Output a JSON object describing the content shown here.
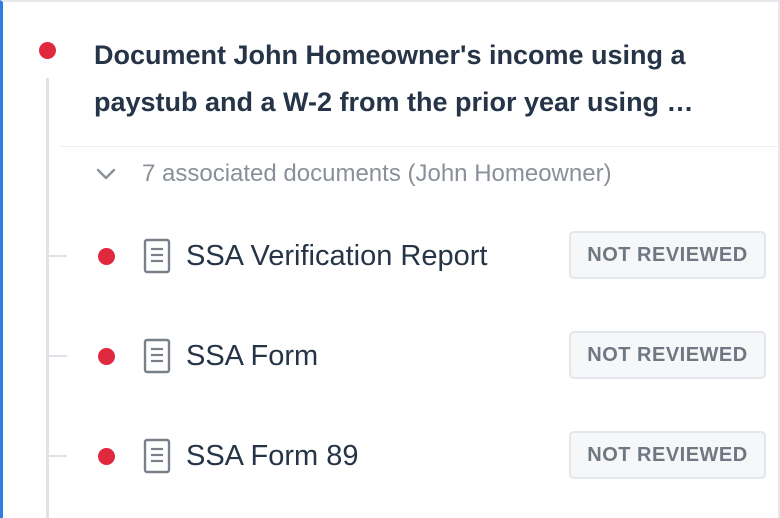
{
  "task": {
    "title_line1": "Document John Homeowner's income using a",
    "title_line2": "paystub and a W-2 from the prior year using …",
    "status_color": "#e0283f"
  },
  "associated": {
    "label": "7 associated documents (John Homeowner)",
    "toggle_icon": "chevron-down-icon"
  },
  "documents": [
    {
      "name": "SSA Verification Report",
      "status": "NOT REVIEWED",
      "icon": "document-icon"
    },
    {
      "name": "SSA Form",
      "status": "NOT REVIEWED",
      "icon": "document-icon"
    },
    {
      "name": "SSA Form 89",
      "status": "NOT REVIEWED",
      "icon": "document-icon"
    }
  ],
  "colors": {
    "accent": "#2f7de1",
    "status_dot": "#e0283f",
    "text": "#263447",
    "muted": "#8a9099"
  }
}
